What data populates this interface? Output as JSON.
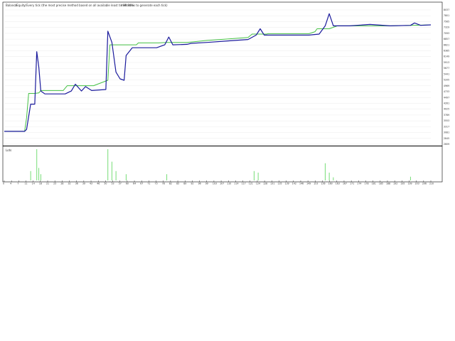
{
  "legend": {
    "balance_label": "Balance",
    "equity_label": "Equity",
    "description": "Every tick (the most precise method based on all available least timeframes to generate each tick)",
    "quality": "99.90%"
  },
  "sub_window": {
    "label": "Lots"
  },
  "colors": {
    "balance": "#1a1a9c",
    "equity": "#44c044",
    "volume": "#77dd77",
    "grid": "#e6e6e6",
    "axis": "#000000",
    "background": "#ffffff"
  },
  "chart_data": [
    {
      "type": "line",
      "title": "",
      "xlabel": "",
      "ylabel": "",
      "x_range": [
        0,
        210
      ],
      "y_range": [
        2510,
        8035
      ],
      "y_ticks": [
        "8037",
        "7801",
        "7565",
        "7329",
        "7093",
        "6857",
        "6621",
        "6385",
        "6149",
        "5913",
        "5677",
        "5441",
        "5205",
        "4969",
        "4733",
        "4497",
        "4261",
        "4025",
        "3789",
        "3553",
        "3317",
        "3081",
        "2845",
        "2609"
      ],
      "x_ticks": [
        "0",
        "4",
        "7",
        "11",
        "14",
        "18",
        "21",
        "25",
        "28",
        "32",
        "36",
        "39",
        "43",
        "46",
        "50",
        "53",
        "57",
        "60",
        "64",
        "67",
        "71",
        "75",
        "78",
        "82",
        "85",
        "89",
        "92",
        "96",
        "99",
        "103",
        "107",
        "110",
        "114",
        "117",
        "121",
        "124",
        "128",
        "131",
        "135",
        "139",
        "142",
        "146",
        "149",
        "153",
        "156",
        "160",
        "163",
        "167",
        "171",
        "174",
        "178",
        "181",
        "185",
        "188",
        "192",
        "195",
        "199",
        "203",
        "206",
        "210"
      ],
      "series": [
        {
          "name": "Balance",
          "points": [
            [
              0,
              3040
            ],
            [
              10,
              3040
            ],
            [
              11,
              3120
            ],
            [
              13,
              4160
            ],
            [
              15,
              4160
            ],
            [
              16,
              6320
            ],
            [
              17,
              5680
            ],
            [
              18,
              4700
            ],
            [
              20,
              4580
            ],
            [
              30,
              4580
            ],
            [
              33,
              4700
            ],
            [
              35,
              4980
            ],
            [
              38,
              4700
            ],
            [
              40,
              4880
            ],
            [
              43,
              4720
            ],
            [
              50,
              4760
            ],
            [
              51,
              7160
            ],
            [
              53,
              6700
            ],
            [
              55,
              5480
            ],
            [
              57,
              5200
            ],
            [
              59,
              5140
            ],
            [
              60,
              6160
            ],
            [
              63,
              6480
            ],
            [
              75,
              6480
            ],
            [
              79,
              6600
            ],
            [
              81,
              6920
            ],
            [
              83,
              6600
            ],
            [
              90,
              6620
            ],
            [
              92,
              6660
            ],
            [
              100,
              6700
            ],
            [
              110,
              6760
            ],
            [
              120,
              6820
            ],
            [
              124,
              7000
            ],
            [
              126,
              7260
            ],
            [
              128,
              7000
            ],
            [
              140,
              7000
            ],
            [
              150,
              7000
            ],
            [
              155,
              7040
            ],
            [
              158,
              7380
            ],
            [
              160,
              7880
            ],
            [
              162,
              7380
            ],
            [
              170,
              7380
            ],
            [
              180,
              7440
            ],
            [
              190,
              7380
            ],
            [
              200,
              7400
            ],
            [
              202,
              7500
            ],
            [
              205,
              7400
            ],
            [
              210,
              7420
            ]
          ]
        },
        {
          "name": "Equity",
          "points": [
            [
              0,
              3040
            ],
            [
              10,
              3040
            ],
            [
              11,
              3600
            ],
            [
              12,
              4600
            ],
            [
              15,
              4600
            ],
            [
              17,
              4620
            ],
            [
              18,
              4720
            ],
            [
              19,
              4720
            ],
            [
              29,
              4720
            ],
            [
              31,
              4920
            ],
            [
              44,
              4920
            ],
            [
              49,
              5080
            ],
            [
              51,
              5140
            ],
            [
              52,
              6600
            ],
            [
              65,
              6600
            ],
            [
              66,
              6680
            ],
            [
              76,
              6680
            ],
            [
              80,
              6700
            ],
            [
              90,
              6700
            ],
            [
              100,
              6780
            ],
            [
              110,
              6840
            ],
            [
              120,
              6900
            ],
            [
              122,
              7040
            ],
            [
              129,
              7040
            ],
            [
              130,
              7060
            ],
            [
              150,
              7060
            ],
            [
              153,
              7140
            ],
            [
              154,
              7260
            ],
            [
              160,
              7260
            ],
            [
              164,
              7380
            ],
            [
              190,
              7380
            ],
            [
              200,
              7400
            ],
            [
              210,
              7420
            ]
          ]
        }
      ]
    },
    {
      "type": "bar",
      "title": "",
      "xlabel": "",
      "ylabel": "",
      "series": [
        {
          "name": "",
          "points": [
            [
              13,
              0.3
            ],
            [
              16,
              1.0
            ],
            [
              17,
              0.4
            ],
            [
              18,
              0.2
            ],
            [
              51,
              1.0
            ],
            [
              53,
              0.6
            ],
            [
              55,
              0.3
            ],
            [
              60,
              0.2
            ],
            [
              80,
              0.2
            ],
            [
              123,
              0.3
            ],
            [
              125,
              0.25
            ],
            [
              158,
              0.55
            ],
            [
              160,
              0.25
            ],
            [
              162,
              0.1
            ],
            [
              200,
              0.12
            ]
          ]
        }
      ]
    }
  ]
}
